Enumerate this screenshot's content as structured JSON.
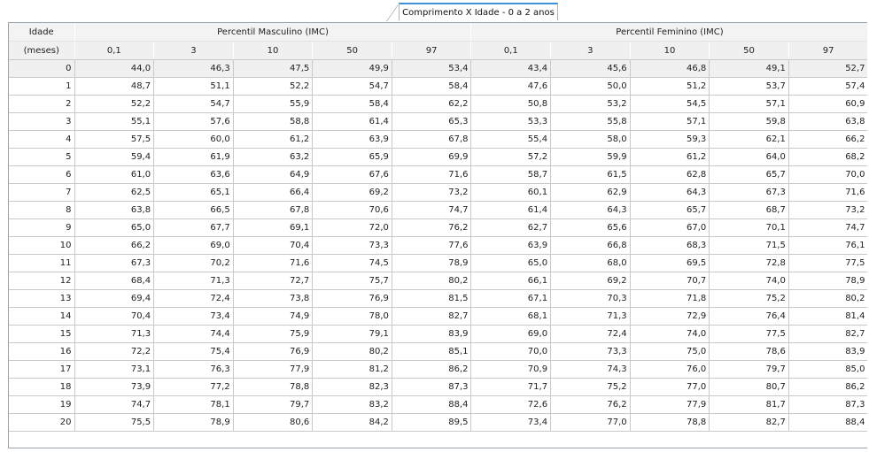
{
  "tab": {
    "label": "Comprimento X Idade - 0 a 2 anos"
  },
  "header": {
    "age_label_line1": "Idade",
    "age_label_line2": "(meses)",
    "group_male": "Percentil Masculino (IMC)",
    "group_female": "Percentil Feminino (IMC)",
    "percentiles_male": [
      "0,1",
      "3",
      "10",
      "50",
      "97"
    ],
    "percentiles_female": [
      "0,1",
      "3",
      "10",
      "50",
      "97"
    ]
  },
  "rows": [
    {
      "age": "0",
      "m": [
        "44,0",
        "46,3",
        "47,5",
        "49,9",
        "53,4"
      ],
      "f": [
        "43,4",
        "45,6",
        "46,8",
        "49,1",
        "52,7"
      ]
    },
    {
      "age": "1",
      "m": [
        "48,7",
        "51,1",
        "52,2",
        "54,7",
        "58,4"
      ],
      "f": [
        "47,6",
        "50,0",
        "51,2",
        "53,7",
        "57,4"
      ]
    },
    {
      "age": "2",
      "m": [
        "52,2",
        "54,7",
        "55,9",
        "58,4",
        "62,2"
      ],
      "f": [
        "50,8",
        "53,2",
        "54,5",
        "57,1",
        "60,9"
      ]
    },
    {
      "age": "3",
      "m": [
        "55,1",
        "57,6",
        "58,8",
        "61,4",
        "65,3"
      ],
      "f": [
        "53,3",
        "55,8",
        "57,1",
        "59,8",
        "63,8"
      ]
    },
    {
      "age": "4",
      "m": [
        "57,5",
        "60,0",
        "61,2",
        "63,9",
        "67,8"
      ],
      "f": [
        "55,4",
        "58,0",
        "59,3",
        "62,1",
        "66,2"
      ]
    },
    {
      "age": "5",
      "m": [
        "59,4",
        "61,9",
        "63,2",
        "65,9",
        "69,9"
      ],
      "f": [
        "57,2",
        "59,9",
        "61,2",
        "64,0",
        "68,2"
      ]
    },
    {
      "age": "6",
      "m": [
        "61,0",
        "63,6",
        "64,9",
        "67,6",
        "71,6"
      ],
      "f": [
        "58,7",
        "61,5",
        "62,8",
        "65,7",
        "70,0"
      ]
    },
    {
      "age": "7",
      "m": [
        "62,5",
        "65,1",
        "66,4",
        "69,2",
        "73,2"
      ],
      "f": [
        "60,1",
        "62,9",
        "64,3",
        "67,3",
        "71,6"
      ]
    },
    {
      "age": "8",
      "m": [
        "63,8",
        "66,5",
        "67,8",
        "70,6",
        "74,7"
      ],
      "f": [
        "61,4",
        "64,3",
        "65,7",
        "68,7",
        "73,2"
      ]
    },
    {
      "age": "9",
      "m": [
        "65,0",
        "67,7",
        "69,1",
        "72,0",
        "76,2"
      ],
      "f": [
        "62,7",
        "65,6",
        "67,0",
        "70,1",
        "74,7"
      ]
    },
    {
      "age": "10",
      "m": [
        "66,2",
        "69,0",
        "70,4",
        "73,3",
        "77,6"
      ],
      "f": [
        "63,9",
        "66,8",
        "68,3",
        "71,5",
        "76,1"
      ]
    },
    {
      "age": "11",
      "m": [
        "67,3",
        "70,2",
        "71,6",
        "74,5",
        "78,9"
      ],
      "f": [
        "65,0",
        "68,0",
        "69,5",
        "72,8",
        "77,5"
      ]
    },
    {
      "age": "12",
      "m": [
        "68,4",
        "71,3",
        "72,7",
        "75,7",
        "80,2"
      ],
      "f": [
        "66,1",
        "69,2",
        "70,7",
        "74,0",
        "78,9"
      ]
    },
    {
      "age": "13",
      "m": [
        "69,4",
        "72,4",
        "73,8",
        "76,9",
        "81,5"
      ],
      "f": [
        "67,1",
        "70,3",
        "71,8",
        "75,2",
        "80,2"
      ]
    },
    {
      "age": "14",
      "m": [
        "70,4",
        "73,4",
        "74,9",
        "78,0",
        "82,7"
      ],
      "f": [
        "68,1",
        "71,3",
        "72,9",
        "76,4",
        "81,4"
      ]
    },
    {
      "age": "15",
      "m": [
        "71,3",
        "74,4",
        "75,9",
        "79,1",
        "83,9"
      ],
      "f": [
        "69,0",
        "72,4",
        "74,0",
        "77,5",
        "82,7"
      ]
    },
    {
      "age": "16",
      "m": [
        "72,2",
        "75,4",
        "76,9",
        "80,2",
        "85,1"
      ],
      "f": [
        "70,0",
        "73,3",
        "75,0",
        "78,6",
        "83,9"
      ]
    },
    {
      "age": "17",
      "m": [
        "73,1",
        "76,3",
        "77,9",
        "81,2",
        "86,2"
      ],
      "f": [
        "70,9",
        "74,3",
        "76,0",
        "79,7",
        "85,0"
      ]
    },
    {
      "age": "18",
      "m": [
        "73,9",
        "77,2",
        "78,8",
        "82,3",
        "87,3"
      ],
      "f": [
        "71,7",
        "75,2",
        "77,0",
        "80,7",
        "86,2"
      ]
    },
    {
      "age": "19",
      "m": [
        "74,7",
        "78,1",
        "79,7",
        "83,2",
        "88,4"
      ],
      "f": [
        "72,6",
        "76,2",
        "77,9",
        "81,7",
        "87,3"
      ]
    },
    {
      "age": "20",
      "m": [
        "75,5",
        "78,9",
        "80,6",
        "84,2",
        "89,5"
      ],
      "f": [
        "73,4",
        "77,0",
        "78,8",
        "82,7",
        "88,4"
      ]
    }
  ]
}
